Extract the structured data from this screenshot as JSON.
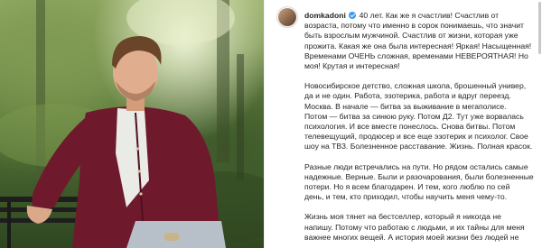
{
  "post": {
    "username": "domkadoni",
    "verified": true,
    "caption_paragraphs": [
      {
        "lines": [
          " 40 лет. Как же я счастлив! Счастлив от",
          "возраста, потому что именно в сорок понимаешь, что значит",
          "быть взрослым мужчиной. Счастлив от жизни, которая уже",
          "прожита. Какая же она была интересная! Яркая! Насыщенная!",
          "Временами ОЧЕНЬ сложная, временами НЕВЕРОЯТНАЯ! Но",
          "моя! Крутая и интересная!"
        ]
      },
      {
        "lines": [
          "Новосибирское детство, сложная школа, брошенный универ,",
          "да и не один. Работа, эзотерика, работа и вдруг переезд.",
          "Москва. В начале — битва за выживание в мегаполисе.",
          "Потом — битва за синюю руку. Потом Д2. Тут уже ворвалась",
          "психология. И все вместе понеслось. Снова битвы. Потом",
          "телевещущий, продюсер и все еще эзотерик и психолог. Свое",
          "шоу на ТВ3. Болезненное расставание. Жизнь. Полная красок."
        ]
      },
      {
        "lines": [
          "Разные люди встречались на пути. Но рядом остались самые",
          "надежные. Верные. Были и разочарования, были болезненные",
          "потери. Но я всем благодарен. И тем, кого люблю по сей",
          "день, и тем, кто приходил, чтобы научить меня чему-то."
        ]
      },
      {
        "lines": [
          "Жизнь моя тянет на бестселлер, который я никогда не",
          "напишу. Потому что работаю с людьми, и их тайны для меня",
          "важнее многих вещей. А история моей жизни без людей не"
        ]
      }
    ]
  },
  "colors": {
    "sweater": "#6e1a2c",
    "verified_badge": "#3897f0",
    "foliage": "#5f7c3c"
  }
}
